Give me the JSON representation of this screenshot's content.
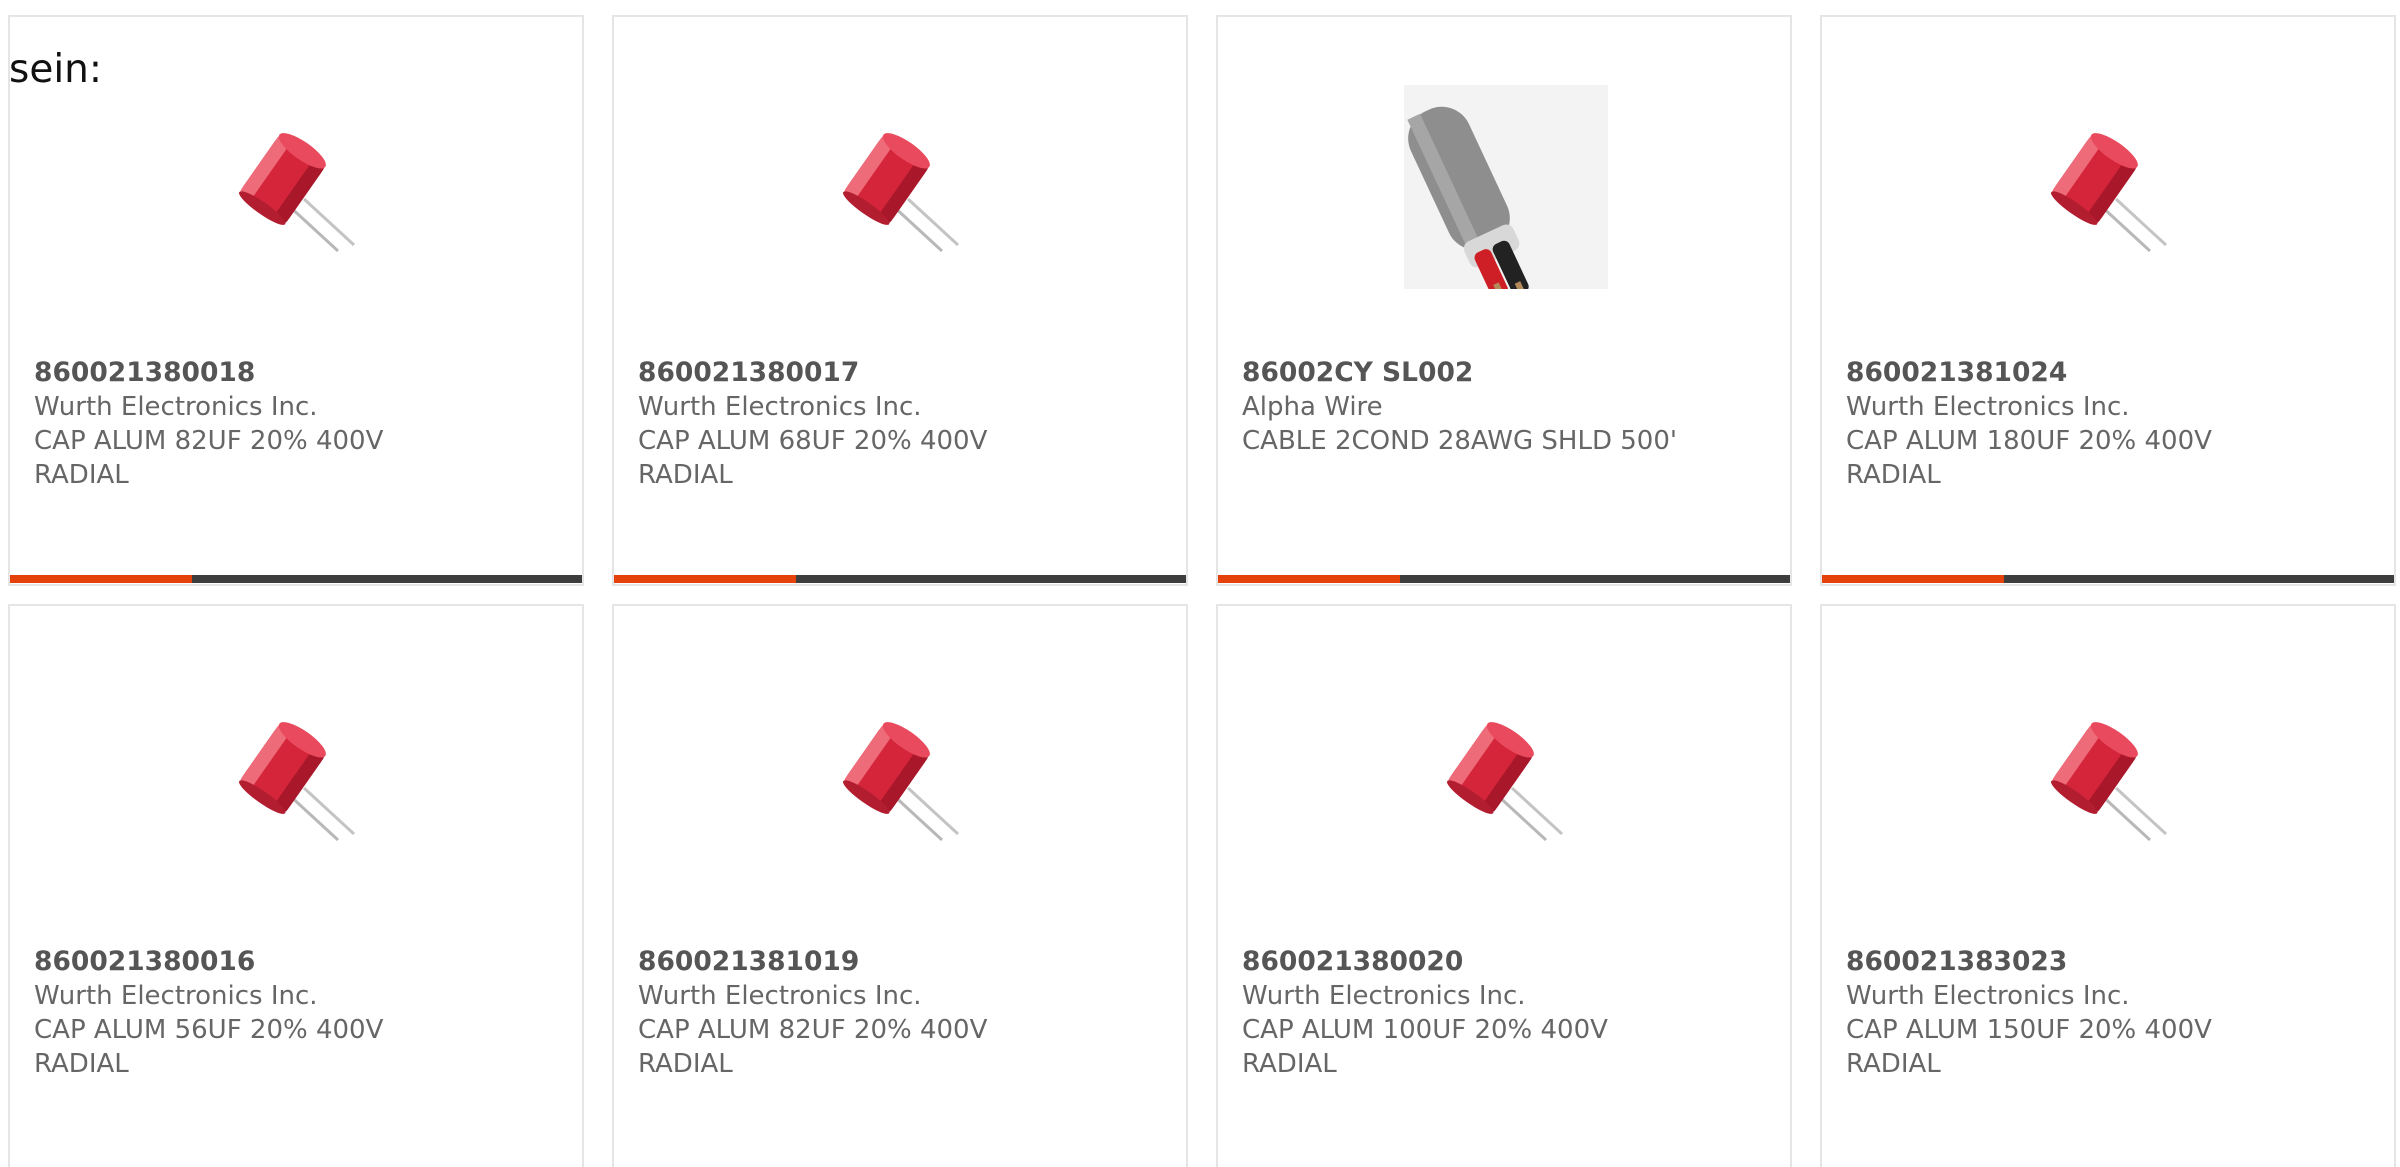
{
  "intro_text": "sein:",
  "products": [
    {
      "part": "860021380018",
      "manufacturer": "Wurth Electronics Inc.",
      "desc_line1": "CAP ALUM 82UF 20% 400V",
      "desc_line2": "RADIAL",
      "image_icon": "red-capacitor-icon"
    },
    {
      "part": "860021380017",
      "manufacturer": "Wurth Electronics Inc.",
      "desc_line1": "CAP ALUM 68UF 20% 400V",
      "desc_line2": "RADIAL",
      "image_icon": "red-capacitor-icon"
    },
    {
      "part": "86002CY SL002",
      "manufacturer": "Alpha Wire",
      "desc_line1": "CABLE 2COND 28AWG SHLD 500'",
      "desc_line2": "",
      "image_icon": "shielded-cable-icon"
    },
    {
      "part": "860021381024",
      "manufacturer": "Wurth Electronics Inc.",
      "desc_line1": "CAP ALUM 180UF 20% 400V",
      "desc_line2": "RADIAL",
      "image_icon": "red-capacitor-icon"
    },
    {
      "part": "860021380016",
      "manufacturer": "Wurth Electronics Inc.",
      "desc_line1": "CAP ALUM 56UF 20% 400V",
      "desc_line2": "RADIAL",
      "image_icon": "red-capacitor-icon"
    },
    {
      "part": "860021381019",
      "manufacturer": "Wurth Electronics Inc.",
      "desc_line1": "CAP ALUM 82UF 20% 400V",
      "desc_line2": "RADIAL",
      "image_icon": "red-capacitor-icon"
    },
    {
      "part": "860021380020",
      "manufacturer": "Wurth Electronics Inc.",
      "desc_line1": "CAP ALUM 100UF 20% 400V",
      "desc_line2": "RADIAL",
      "image_icon": "red-capacitor-icon"
    },
    {
      "part": "860021383023",
      "manufacturer": "Wurth Electronics Inc.",
      "desc_line1": "CAP ALUM 150UF 20% 400V",
      "desc_line2": "RADIAL",
      "image_icon": "red-capacitor-icon"
    }
  ],
  "colors": {
    "accent": "#e4410b",
    "bar_dark": "#3d3d3d",
    "border": "#e5e5e5",
    "text_gray": "#666666"
  }
}
